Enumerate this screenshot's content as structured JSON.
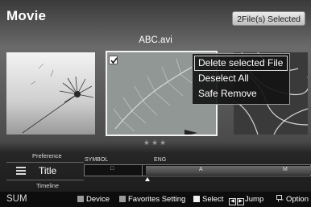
{
  "header": {
    "title": "Movie",
    "file_count": "2File(s) Selected",
    "current_file": "ABC.avi"
  },
  "context_menu": {
    "items": [
      {
        "label": "Delete selected File",
        "selected": true
      },
      {
        "label": "Deselect All",
        "selected": false
      },
      {
        "label": "Safe Remove",
        "selected": false
      }
    ]
  },
  "rating": "★★★",
  "sort_panel": {
    "prev_option": "Preference",
    "current_option": "Title",
    "next_option": "Timeline"
  },
  "index_bar": {
    "symbol_label": "SYMBOL",
    "eng_label": "ENG",
    "symbol_marker": "□",
    "eng_marker_a": "A",
    "eng_marker_m": "M"
  },
  "footer": {
    "sum": "SUM",
    "device": "Device",
    "favorites": "Favorites Setting",
    "select": "Select",
    "jump": "Jump",
    "option": "Option"
  },
  "icons": [
    "checkbox-icon",
    "list-icon",
    "jump-icon",
    "option-icon"
  ],
  "colors": {
    "accent_gray": "#9a9a9a",
    "menu_bg": "#141414",
    "file_badge": "#d9d9d9"
  }
}
